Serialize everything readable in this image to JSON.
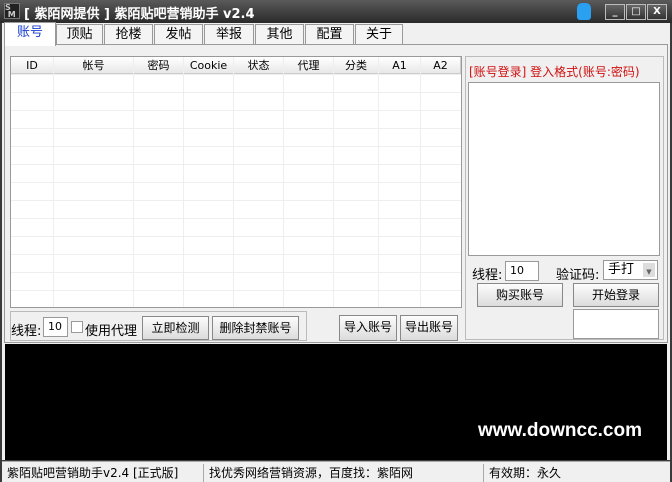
{
  "window": {
    "title": "[ 紫陌网提供 ] 紫陌贴吧营销助手 v2.4",
    "minimize": "_",
    "maximize": "□",
    "close": "X"
  },
  "tabs": [
    "账号",
    "顶贴",
    "抢楼",
    "发帖",
    "举报",
    "其他",
    "配置",
    "关于"
  ],
  "grid": {
    "columns": [
      "ID",
      "帐号",
      "密码",
      "Cookie",
      "状态",
      "代理",
      "分类",
      "A1",
      "A2"
    ]
  },
  "login": {
    "hint": "[账号登录] 登入格式(账号:密码)",
    "threads_label": "线程:",
    "threads_value": "10",
    "captcha_label": "验证码:",
    "captcha_value": "手打",
    "buy_button": "购买账号",
    "start_button": "开始登录"
  },
  "toolbar": {
    "threads_label": "线程:",
    "threads_value": "10",
    "proxy_label": "使用代理",
    "check_button": "立即检测",
    "delete_button": "删除封禁账号",
    "import_button": "导入账号",
    "export_button": "导出账号"
  },
  "watermark": "www.downcc.com",
  "status": {
    "app": "紫陌贴吧营销助手v2.4 [正式版]",
    "ad": "找优秀网络营销资源，百度找：紫陌网",
    "expiry": "有效期：永久"
  }
}
